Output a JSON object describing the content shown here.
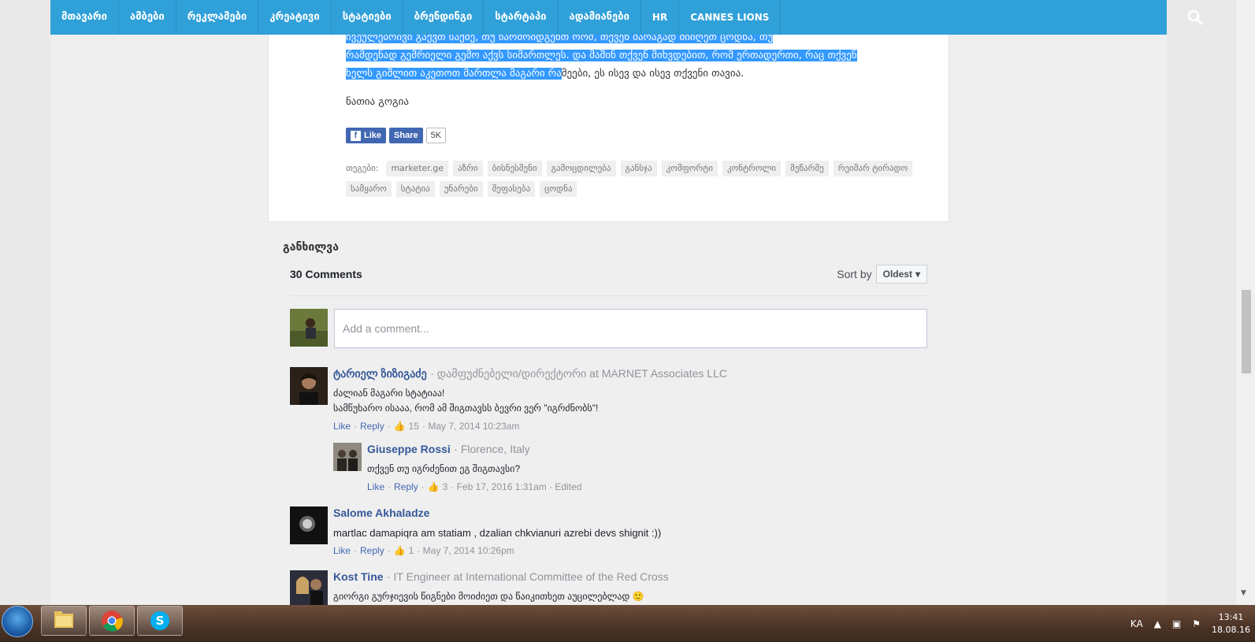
{
  "nav": {
    "items": [
      "მთავარი",
      "ამბები",
      "რეკლამები",
      "კრეატივი",
      "სტატიები",
      "ბრენდინგი",
      "სტარტაპი",
      "ადამიანები",
      "HR",
      "CANNES LIONS"
    ],
    "search_icon": "search-icon"
  },
  "article": {
    "line1_hl": "ჩვეულებრივი გაქვთ საქმე, თუ წარმოიდგენთ რომ, თქვენ მარაგად მიიღეთ ცოდნა, თუ",
    "line2_hl": "რამდენად გემრიელი გემო აქვს სიმართლეს. და მაშინ თქვენ მიხვდებით, რომ ერთადერთი, რაც თქვენ",
    "line3_hl": "ხელს გიშლით აკეთოთ მართლა მაგარი რა",
    "line3_rest": "მეები, ეს ისევ და ისევ თქვენი თავია.",
    "author": "ნათია გოგია"
  },
  "social": {
    "like_label": "Like",
    "share_label": "Share",
    "count": "5K"
  },
  "tags": {
    "label": "თეგები:",
    "items": [
      "marketer.ge",
      "აზრი",
      "ბისნესმენი",
      "გამოცდილება",
      "განსჯა",
      "კომფორტი",
      "კონტროლი",
      "მეწარმე",
      "რეიმარ ტირადო",
      "სამყარო",
      "სტატია",
      "უნარები",
      "შეფასება",
      "ცოდნა"
    ]
  },
  "discussion": {
    "title": "განხილვა",
    "comments_count": "30 Comments",
    "sort_by": "Sort by",
    "sort_value": "Oldest",
    "placeholder": "Add a comment..."
  },
  "comments": [
    {
      "name": "ტარიელ ზიზიგაძე",
      "meta": "· დამფუძნებელი/დირექტორი at MARNET Associates LLC",
      "text1": "ძალიან მაგარი სტატიაა!",
      "text2": "სამწუხარო ისააა, რომ ამ შიგთავსს ბევრი ვერ \"იგრძნობს\"!",
      "like": "Like",
      "reply": "Reply",
      "likes": "15",
      "date": "· May 7, 2014 10:23am"
    },
    {
      "name": "Giuseppe Rossi",
      "meta": "· Florence, Italy",
      "text1": "თქვენ თუ იგრძენით ეგ შიგთავსი?",
      "like": "Like",
      "reply": "Reply",
      "likes": "3",
      "date": "· Feb 17, 2016 1:31am · Edited"
    },
    {
      "name": "Salome Akhaladze",
      "meta": "",
      "text1": "martlac damapiqra am statiam , dzalian chkvianuri azrebi devs shignit :))",
      "like": "Like",
      "reply": "Reply",
      "likes": "1",
      "date": "· May 7, 2014 10:26pm"
    },
    {
      "name": "Kost Tine",
      "meta": "· IT Engineer at International Committee of the Red Cross",
      "text1": "გიორგი გურჯიევის წიგნები მოიძიეთ და წაიკითხეთ აუცილებლად 🙂"
    }
  ],
  "taskbar": {
    "lang": "KA",
    "time": "13:41",
    "date": "18.08.16"
  },
  "colors": {
    "nav_bg": "#30a0d9",
    "highlight": "#3399ff",
    "fb_blue": "#4267b2",
    "name_blue": "#365899"
  }
}
